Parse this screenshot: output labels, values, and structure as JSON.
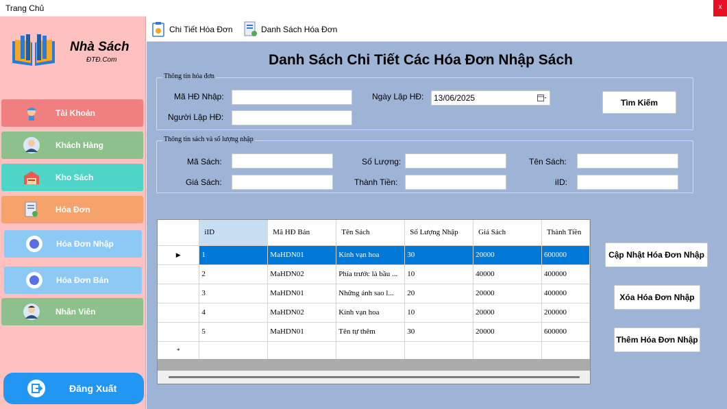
{
  "window": {
    "title": "Trang Chủ",
    "close_label": "x"
  },
  "brand": {
    "name": "Nhà Sách",
    "sub": "ĐTĐ.Com"
  },
  "sidebar": {
    "items": [
      {
        "label": "Tài Khoản",
        "icon": "user-helmet-icon",
        "color": "#f07f7f"
      },
      {
        "label": "Khách Hàng",
        "icon": "customer-icon",
        "color": "#8dc08a"
      },
      {
        "label": "Kho Sách",
        "icon": "warehouse-icon",
        "color": "#4fd4c8"
      },
      {
        "label": "Hóa Đơn",
        "icon": "invoice-icon",
        "color": "#f5a36b"
      },
      {
        "label": "Hóa Đơn Nhập",
        "icon": "radio-dot-icon",
        "color": "#8cc9f5"
      },
      {
        "label": "Hóa Đơn Bán",
        "icon": "radio-dot-icon",
        "color": "#8cc9f5"
      },
      {
        "label": "Nhân Viên",
        "icon": "employee-icon",
        "color": "#8dc08a"
      }
    ],
    "logout_label": "Đăng Xuất"
  },
  "toolbar": {
    "detail_label": "Chi Tiết Hóa Đơn",
    "list_label": "Danh Sách Hóa Đơn"
  },
  "main": {
    "heading": "Danh Sách Chi Tiết Các Hóa Đơn Nhập Sách",
    "invoice_group": {
      "title": "Thông tin hóa đơn",
      "import_id_label": "Mã HĐ Nhập:",
      "import_id_value": "",
      "creator_label": "Người Lập HĐ:",
      "creator_value": "",
      "date_label": "Ngày Lập HĐ:",
      "date_value": "13/06/2025",
      "search_label": "Tìm Kiếm"
    },
    "book_group": {
      "title": "Thông tin sách và số lượng nhập",
      "book_id_label": "Mã Sách:",
      "qty_label": "Số Lượng:",
      "book_name_label": "Tên Sách:",
      "price_label": "Giá Sách:",
      "total_label": "Thành Tiền:",
      "iid_label": "iID:"
    },
    "grid": {
      "columns": [
        "iID",
        "Mã HĐ Bán",
        "Tên Sách",
        "Số Lượng Nhập",
        "Giá Sách",
        "Thành Tiền"
      ],
      "rows": [
        [
          "1",
          "MaHDN01",
          "Kính vạn hoa",
          "30",
          "20000",
          "600000"
        ],
        [
          "2",
          "MaHDN02",
          "Phía trước là bầu ...",
          "10",
          "40000",
          "400000"
        ],
        [
          "3",
          "MaHDN01",
          "Những ánh sao l...",
          "20",
          "20000",
          "400000"
        ],
        [
          "4",
          "MaHDN02",
          "Kính vạn hoa",
          "10",
          "20000",
          "200000"
        ],
        [
          "5",
          "MaHDN01",
          "Tên tự thêm",
          "30",
          "20000",
          "600000"
        ]
      ],
      "selected_row_marker": "▶",
      "new_row_marker": "*"
    },
    "actions": {
      "update_label": "Cập Nhật Hóa Đơn Nhập",
      "delete_label": "Xóa Hóa Đơn Nhập",
      "add_label": "Thêm Hóa Đơn Nhập"
    }
  }
}
